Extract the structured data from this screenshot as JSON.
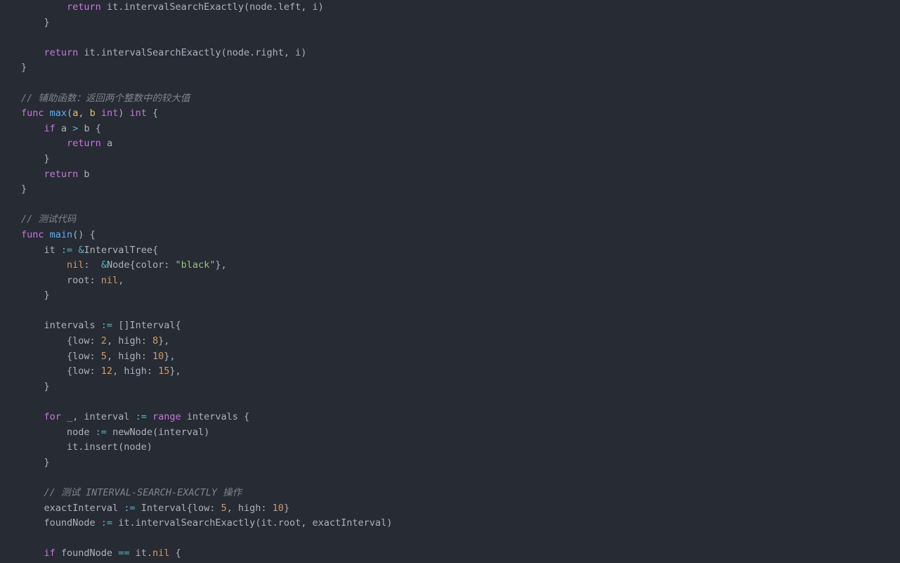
{
  "code_lines": [
    [
      {
        "t": "        ",
        "c": "c-default"
      },
      {
        "t": "return",
        "c": "c-keyword"
      },
      {
        "t": " it.intervalSearchExactly(node.left, i)",
        "c": "c-ident"
      }
    ],
    [
      {
        "t": "    }",
        "c": "c-punct"
      }
    ],
    [],
    [
      {
        "t": "    ",
        "c": "c-default"
      },
      {
        "t": "return",
        "c": "c-keyword"
      },
      {
        "t": " it.intervalSearchExactly(node.right, i)",
        "c": "c-ident"
      }
    ],
    [
      {
        "t": "}",
        "c": "c-punct"
      }
    ],
    [],
    [
      {
        "t": "// 辅助函数：返回两个整数中的较大值",
        "c": "c-comment"
      }
    ],
    [
      {
        "t": "func",
        "c": "c-keyword"
      },
      {
        "t": " ",
        "c": "c-default"
      },
      {
        "t": "max",
        "c": "c-funcname"
      },
      {
        "t": "(",
        "c": "c-punct"
      },
      {
        "t": "a",
        "c": "c-var"
      },
      {
        "t": ", ",
        "c": "c-punct"
      },
      {
        "t": "b",
        "c": "c-var"
      },
      {
        "t": " ",
        "c": "c-default"
      },
      {
        "t": "int",
        "c": "c-type"
      },
      {
        "t": ") ",
        "c": "c-punct"
      },
      {
        "t": "int",
        "c": "c-type"
      },
      {
        "t": " {",
        "c": "c-punct"
      }
    ],
    [
      {
        "t": "    ",
        "c": "c-default"
      },
      {
        "t": "if",
        "c": "c-keyword"
      },
      {
        "t": " a ",
        "c": "c-ident"
      },
      {
        "t": ">",
        "c": "c-op"
      },
      {
        "t": " b {",
        "c": "c-ident"
      }
    ],
    [
      {
        "t": "        ",
        "c": "c-default"
      },
      {
        "t": "return",
        "c": "c-keyword"
      },
      {
        "t": " a",
        "c": "c-ident"
      }
    ],
    [
      {
        "t": "    }",
        "c": "c-punct"
      }
    ],
    [
      {
        "t": "    ",
        "c": "c-default"
      },
      {
        "t": "return",
        "c": "c-keyword"
      },
      {
        "t": " b",
        "c": "c-ident"
      }
    ],
    [
      {
        "t": "}",
        "c": "c-punct"
      }
    ],
    [],
    [
      {
        "t": "// 测试代码",
        "c": "c-comment"
      }
    ],
    [
      {
        "t": "func",
        "c": "c-keyword"
      },
      {
        "t": " ",
        "c": "c-default"
      },
      {
        "t": "main",
        "c": "c-funcname"
      },
      {
        "t": "()",
        "c": "c-punct"
      },
      {
        "t": " {",
        "c": "c-punct"
      }
    ],
    [
      {
        "t": "    it ",
        "c": "c-ident"
      },
      {
        "t": ":=",
        "c": "c-op"
      },
      {
        "t": " ",
        "c": "c-default"
      },
      {
        "t": "&",
        "c": "c-op"
      },
      {
        "t": "IntervalTree{",
        "c": "c-ident"
      }
    ],
    [
      {
        "t": "        ",
        "c": "c-default"
      },
      {
        "t": "nil",
        "c": "c-nil"
      },
      {
        "t": ":  ",
        "c": "c-punct"
      },
      {
        "t": "&",
        "c": "c-op"
      },
      {
        "t": "Node{color: ",
        "c": "c-ident"
      },
      {
        "t": "\"black\"",
        "c": "c-str"
      },
      {
        "t": "},",
        "c": "c-punct"
      }
    ],
    [
      {
        "t": "        root: ",
        "c": "c-ident"
      },
      {
        "t": "nil",
        "c": "c-nil"
      },
      {
        "t": ",",
        "c": "c-punct"
      }
    ],
    [
      {
        "t": "    }",
        "c": "c-punct"
      }
    ],
    [],
    [
      {
        "t": "    intervals ",
        "c": "c-ident"
      },
      {
        "t": ":=",
        "c": "c-op"
      },
      {
        "t": " []Interval{",
        "c": "c-ident"
      }
    ],
    [
      {
        "t": "        {low: ",
        "c": "c-ident"
      },
      {
        "t": "2",
        "c": "c-num"
      },
      {
        "t": ", high: ",
        "c": "c-ident"
      },
      {
        "t": "8",
        "c": "c-num"
      },
      {
        "t": "},",
        "c": "c-punct"
      }
    ],
    [
      {
        "t": "        {low: ",
        "c": "c-ident"
      },
      {
        "t": "5",
        "c": "c-num"
      },
      {
        "t": ", high: ",
        "c": "c-ident"
      },
      {
        "t": "10",
        "c": "c-num"
      },
      {
        "t": "},",
        "c": "c-punct"
      }
    ],
    [
      {
        "t": "        {low: ",
        "c": "c-ident"
      },
      {
        "t": "12",
        "c": "c-num"
      },
      {
        "t": ", high: ",
        "c": "c-ident"
      },
      {
        "t": "15",
        "c": "c-num"
      },
      {
        "t": "},",
        "c": "c-punct"
      }
    ],
    [
      {
        "t": "    }",
        "c": "c-punct"
      }
    ],
    [],
    [
      {
        "t": "    ",
        "c": "c-default"
      },
      {
        "t": "for",
        "c": "c-keyword"
      },
      {
        "t": " _, interval ",
        "c": "c-ident"
      },
      {
        "t": ":=",
        "c": "c-op"
      },
      {
        "t": " ",
        "c": "c-default"
      },
      {
        "t": "range",
        "c": "c-keyword"
      },
      {
        "t": " intervals {",
        "c": "c-ident"
      }
    ],
    [
      {
        "t": "        node ",
        "c": "c-ident"
      },
      {
        "t": ":=",
        "c": "c-op"
      },
      {
        "t": " newNode(interval)",
        "c": "c-ident"
      }
    ],
    [
      {
        "t": "        it.insert(node)",
        "c": "c-ident"
      }
    ],
    [
      {
        "t": "    }",
        "c": "c-punct"
      }
    ],
    [],
    [
      {
        "t": "    ",
        "c": "c-default"
      },
      {
        "t": "// 测试 INTERVAL-SEARCH-EXACTLY 操作",
        "c": "c-comment"
      }
    ],
    [
      {
        "t": "    exactInterval ",
        "c": "c-ident"
      },
      {
        "t": ":=",
        "c": "c-op"
      },
      {
        "t": " Interval{low: ",
        "c": "c-ident"
      },
      {
        "t": "5",
        "c": "c-num"
      },
      {
        "t": ", high: ",
        "c": "c-ident"
      },
      {
        "t": "10",
        "c": "c-num"
      },
      {
        "t": "}",
        "c": "c-punct"
      }
    ],
    [
      {
        "t": "    foundNode ",
        "c": "c-ident"
      },
      {
        "t": ":=",
        "c": "c-op"
      },
      {
        "t": " it.intervalSearchExactly(it.root, exactInterval)",
        "c": "c-ident"
      }
    ],
    [],
    [
      {
        "t": "    ",
        "c": "c-default"
      },
      {
        "t": "if",
        "c": "c-keyword"
      },
      {
        "t": " foundNode ",
        "c": "c-ident"
      },
      {
        "t": "==",
        "c": "c-op"
      },
      {
        "t": " it.",
        "c": "c-ident"
      },
      {
        "t": "nil",
        "c": "c-nil"
      },
      {
        "t": " {",
        "c": "c-punct"
      }
    ]
  ]
}
